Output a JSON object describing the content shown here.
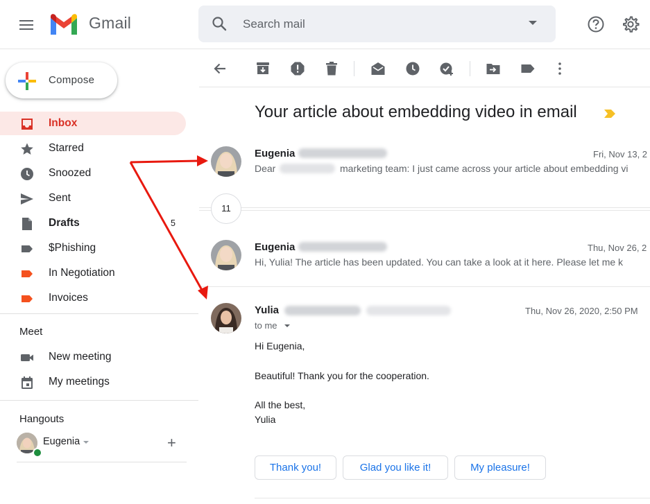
{
  "header": {
    "brand": "Gmail",
    "search_placeholder": "Search mail"
  },
  "sidebar": {
    "compose_label": "Compose",
    "items": [
      {
        "label": "Inbox",
        "icon": "inbox-icon"
      },
      {
        "label": "Starred",
        "icon": "star-icon"
      },
      {
        "label": "Snoozed",
        "icon": "clock-icon"
      },
      {
        "label": "Sent",
        "icon": "send-icon"
      },
      {
        "label": "Drafts",
        "icon": "draft-icon",
        "count": "5"
      },
      {
        "label": "$Phishing",
        "icon": "label-icon"
      },
      {
        "label": "In Negotiation",
        "icon": "label-icon"
      },
      {
        "label": "Invoices",
        "icon": "label-icon"
      }
    ],
    "meet": {
      "title": "Meet",
      "items": [
        {
          "label": "New meeting",
          "icon": "video-camera-icon"
        },
        {
          "label": "My meetings",
          "icon": "calendar-icon"
        }
      ]
    },
    "hangouts": {
      "title": "Hangouts",
      "user": "Eugenia"
    }
  },
  "colors": {
    "inbox_active_bg": "#fce8e6",
    "inbox_active_text": "#d93025",
    "phishing_label": "#5f6368",
    "negotiation_label": "#f4511e",
    "invoices_label": "#f4511e",
    "important_marker": "#f6c026",
    "link_blue": "#1a73e8",
    "annotation_arrow": "#e8190f"
  },
  "thread": {
    "subject": "Your article about embedding video in email",
    "collapsed_count": "11",
    "messages": [
      {
        "sender": "Eugenia",
        "date": "Fri, Nov 13, 2",
        "snippet_prefix": "Dear",
        "snippet": "marketing team: I just came across your article about embedding vi"
      },
      {
        "sender": "Eugenia",
        "date": "Thu, Nov 26, 2",
        "snippet": "Hi, Yulia! The article has been updated. You can take a look at it here. Please let me k"
      },
      {
        "sender": "Yulia",
        "date": "Thu, Nov 26, 2020, 2:50 PM",
        "to": "to me",
        "greeting": "Hi Eugenia,",
        "body": "Beautiful! Thank you for the cooperation.",
        "closing": "All the best,",
        "signature": "Yulia"
      }
    ],
    "smart_replies": [
      "Thank you!",
      "Glad you like it!",
      "My pleasure!"
    ]
  }
}
